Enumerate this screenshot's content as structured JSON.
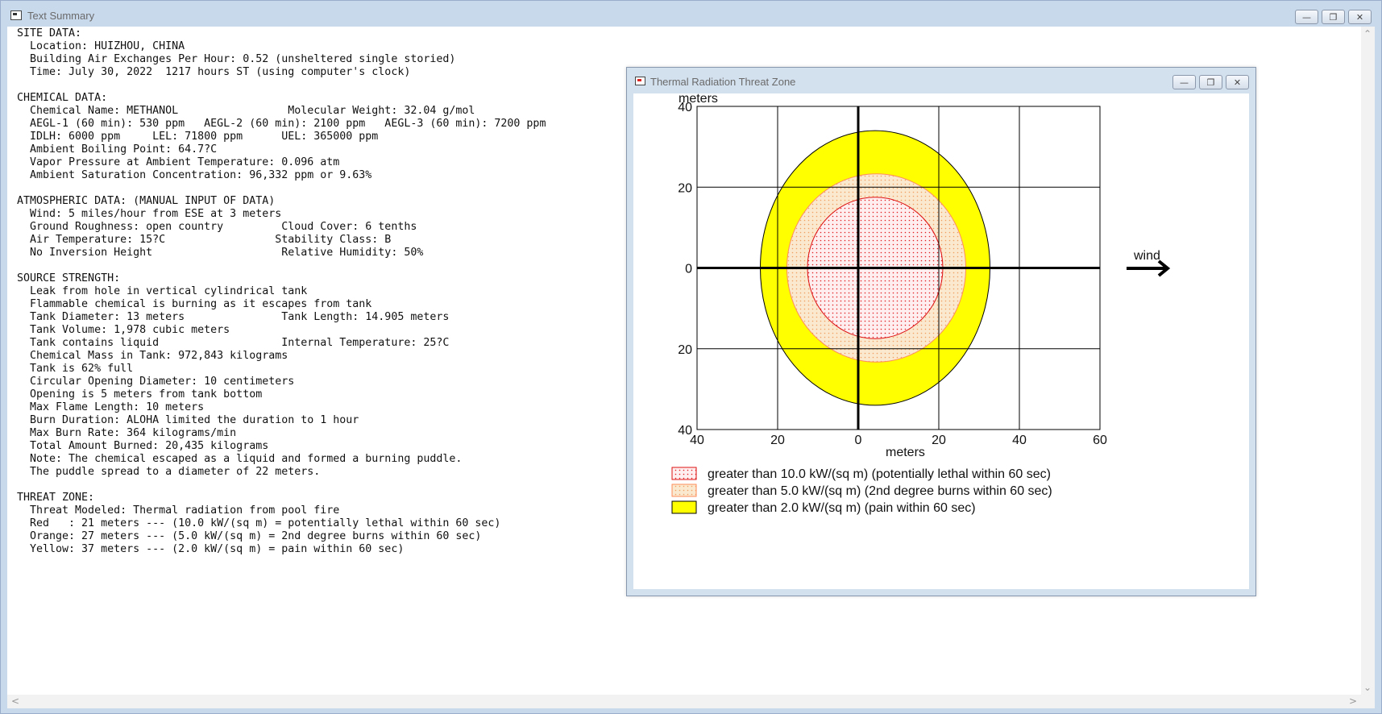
{
  "main_window": {
    "title": "Text Summary",
    "summary_lines": [
      "SITE DATA:",
      "  Location: HUIZHOU, CHINA",
      "  Building Air Exchanges Per Hour: 0.52 (unsheltered single storied)",
      "  Time: July 30, 2022  1217 hours ST (using computer's clock)",
      "",
      "CHEMICAL DATA:",
      "  Chemical Name: METHANOL                 Molecular Weight: 32.04 g/mol",
      "  AEGL-1 (60 min): 530 ppm   AEGL-2 (60 min): 2100 ppm   AEGL-3 (60 min): 7200 ppm",
      "  IDLH: 6000 ppm     LEL: 71800 ppm      UEL: 365000 ppm",
      "  Ambient Boiling Point: 64.7?C",
      "  Vapor Pressure at Ambient Temperature: 0.096 atm",
      "  Ambient Saturation Concentration: 96,332 ppm or 9.63%",
      "",
      "ATMOSPHERIC DATA: (MANUAL INPUT OF DATA)",
      "  Wind: 5 miles/hour from ESE at 3 meters",
      "  Ground Roughness: open country         Cloud Cover: 6 tenths",
      "  Air Temperature: 15?C                 Stability Class: B",
      "  No Inversion Height                    Relative Humidity: 50%",
      "",
      "SOURCE STRENGTH:",
      "  Leak from hole in vertical cylindrical tank",
      "  Flammable chemical is burning as it escapes from tank",
      "  Tank Diameter: 13 meters               Tank Length: 14.905 meters",
      "  Tank Volume: 1,978 cubic meters",
      "  Tank contains liquid                   Internal Temperature: 25?C",
      "  Chemical Mass in Tank: 972,843 kilograms",
      "  Tank is 62% full",
      "  Circular Opening Diameter: 10 centimeters",
      "  Opening is 5 meters from tank bottom",
      "  Max Flame Length: 10 meters",
      "  Burn Duration: ALOHA limited the duration to 1 hour",
      "  Max Burn Rate: 364 kilograms/min",
      "  Total Amount Burned: 20,435 kilograms",
      "  Note: The chemical escaped as a liquid and formed a burning puddle.",
      "  The puddle spread to a diameter of 22 meters.",
      "",
      "THREAT ZONE:",
      "  Threat Modeled: Thermal radiation from pool fire",
      "  Red   : 21 meters --- (10.0 kW/(sq m) = potentially lethal within 60 sec)",
      "  Orange: 27 meters --- (5.0 kW/(sq m) = 2nd degree burns within 60 sec)",
      "  Yellow: 37 meters --- (2.0 kW/(sq m) = pain within 60 sec)"
    ]
  },
  "threat_window": {
    "title": "Thermal Radiation Threat Zone"
  },
  "chart_data": {
    "type": "area",
    "y_axis_label": "meters",
    "x_axis_label": "meters",
    "x_ticks": [
      "40",
      "20",
      "0",
      "20",
      "40",
      "60"
    ],
    "y_ticks": [
      "40",
      "20",
      "0",
      "20",
      "40"
    ],
    "xlim": [
      -40,
      60
    ],
    "ylim": [
      -40,
      40
    ],
    "grid": true,
    "wind_label": "wind",
    "wind_direction": "east",
    "zones": [
      {
        "name": "Yellow",
        "threshold_label": "greater than 2.0 kW/(sq m) (pain within 60 sec)",
        "center_x": 4.2,
        "center_y": 0,
        "radius_x": 28.5,
        "radius_y": 34,
        "fill": "#ffff00",
        "stroke": "#000000"
      },
      {
        "name": "Orange",
        "threshold_label": "greater than 5.0 kW/(sq m) (2nd degree burns within 60 sec)",
        "center_x": 4.5,
        "center_y": 0,
        "radius_x": 22.2,
        "radius_y": 23.3,
        "fill": "#f6dfc0",
        "stroke": "#ff8c5a"
      },
      {
        "name": "Red",
        "threshold_label": "greater than 10.0 kW/(sq m) (potentially lethal within 60 sec)",
        "center_x": 4.2,
        "center_y": 0,
        "radius_x": 16.8,
        "radius_y": 17.5,
        "fill": "#ffe7ea",
        "stroke": "#dd1111"
      }
    ],
    "legend": [
      {
        "label": "greater than 10.0 kW/(sq m) (potentially lethal within 60 sec)",
        "color": "#ffe7ea",
        "border": "#dd1111",
        "pattern": "red-dots"
      },
      {
        "label": "greater than 5.0 kW/(sq m) (2nd degree burns within 60 sec)",
        "color": "#f6dfc0",
        "border": "#ff8c5a",
        "pattern": "orange-dots"
      },
      {
        "label": "greater than 2.0 kW/(sq m) (pain within 60 sec)",
        "color": "#ffff00",
        "border": "#000000",
        "pattern": "solid"
      }
    ]
  }
}
